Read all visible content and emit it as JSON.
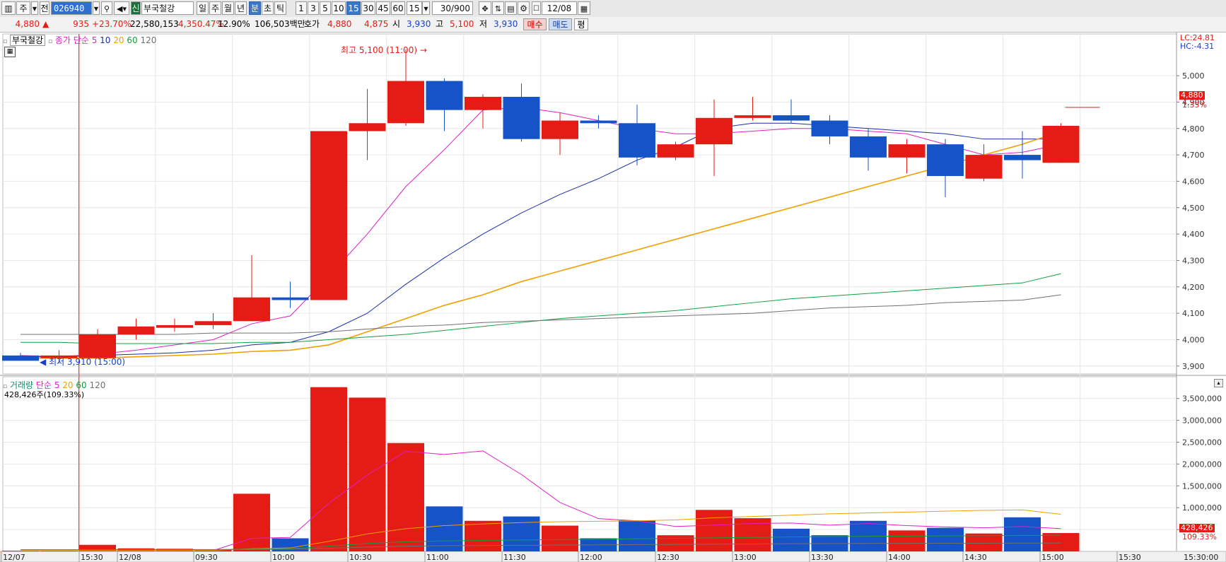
{
  "toolbar": {
    "type_selector": "주",
    "prev_label": "전",
    "stock_code": "026940",
    "sound_icon": "speaker-icon",
    "new_badge": "신",
    "stock_name": "부국철강",
    "period_day": "일",
    "period_week": "주",
    "period_month": "월",
    "period_year": "년",
    "period_minute": "분",
    "period_second": "초",
    "period_tick": "틱",
    "intervals": [
      "1",
      "3",
      "5",
      "10",
      "15",
      "30",
      "45",
      "60"
    ],
    "selected_interval": "15",
    "interval_select_value": "15",
    "count_value": "30/900",
    "date_value": "12/08"
  },
  "quote": {
    "price": "4,880",
    "change_sign": "▲",
    "change": "935",
    "change_pct": "+23.70%",
    "volume": "22,580,153",
    "volume_pct": "4,350.47%",
    "turnover": "12.90%",
    "amount": "106,503백만",
    "hoga_label": "호가",
    "ask": "4,880",
    "bid": "4,875",
    "open_label": "시",
    "open": "3,930",
    "high_label": "고",
    "high": "5,100",
    "low_label": "저",
    "low": "3,930",
    "buy_button": "매수",
    "sell_button": "매도",
    "eval_button": "평"
  },
  "price_panel": {
    "stock_label": "부국철강",
    "ma_prefix": "종가 단순",
    "ma_periods": [
      "5",
      "10",
      "20",
      "60",
      "120"
    ],
    "ma_colors": [
      "#e020c8",
      "#1a2ea8",
      "#f0a000",
      "#10a040",
      "#707070"
    ],
    "lc_label": "LC:24.81",
    "hc_label": "HC:-4.31",
    "high_annotation": "최고 5,100 (11:00)",
    "low_annotation": "최저 3,910 (15:00)",
    "current_price": "4,880",
    "current_pct": "1.35%",
    "y_ticks": [
      "5,000",
      "4,900",
      "4,800",
      "4,700",
      "4,600",
      "4,500",
      "4,400",
      "4,300",
      "4,200",
      "4,100",
      "4,000",
      "3,900"
    ]
  },
  "volume_panel": {
    "label": "거래량",
    "ma_prefix": "단순",
    "ma_periods": [
      "5",
      "20",
      "60",
      "120"
    ],
    "ma_colors": [
      "#e020c8",
      "#f0a000",
      "#10a040",
      "#707070"
    ],
    "volume_readout": "428,426주(109.33%)",
    "current_volume": "428,426",
    "current_pct": "109.33%",
    "y_ticks": [
      "3,500,000",
      "3,000,000",
      "2,500,000",
      "2,000,000",
      "1,500,000",
      "1,000,000",
      "500,000"
    ]
  },
  "x_axis": {
    "labels": [
      "12/07",
      "15:30",
      "12/08",
      "09:30",
      "10:00",
      "10:30",
      "11:00",
      "11:30",
      "12:00",
      "12:30",
      "13:00",
      "13:30",
      "14:00",
      "14:30",
      "15:00",
      "15:30",
      "15:30:00"
    ]
  },
  "colors": {
    "up": "#e51b16",
    "down": "#1652c8",
    "grid": "#e6e6e6",
    "session_line": "#e51b16"
  },
  "chart_data": {
    "type": "candlestick",
    "price_range": [
      3870,
      5110
    ],
    "volume_range": [
      0,
      3900000
    ],
    "candles": [
      {
        "t": "12/07 15:15",
        "o": 3940,
        "h": 3950,
        "l": 3920,
        "c": 3920
      },
      {
        "t": "12/07 15:30",
        "o": 3930,
        "h": 3960,
        "l": 3910,
        "c": 3940
      },
      {
        "t": "12/08 09:15",
        "o": 3930,
        "h": 4040,
        "l": 3930,
        "c": 4020
      },
      {
        "t": "12/08 09:30",
        "o": 4020,
        "h": 4080,
        "l": 4000,
        "c": 4050
      },
      {
        "t": "12/08 09:45",
        "o": 4045,
        "h": 4080,
        "l": 4030,
        "c": 4055
      },
      {
        "t": "12/08 10:00",
        "o": 4055,
        "h": 4100,
        "l": 4040,
        "c": 4070
      },
      {
        "t": "12/08 10:15",
        "o": 4070,
        "h": 4320,
        "l": 4070,
        "c": 4160
      },
      {
        "t": "12/08 10:30",
        "o": 4160,
        "h": 4220,
        "l": 4120,
        "c": 4150
      },
      {
        "t": "12/08 10:45",
        "o": 4150,
        "h": 4790,
        "l": 4150,
        "c": 4790
      },
      {
        "t": "12/08 11:00",
        "o": 4790,
        "h": 4950,
        "l": 4680,
        "c": 4820
      },
      {
        "t": "12/08 11:15",
        "o": 4820,
        "h": 5100,
        "l": 4810,
        "c": 4980
      },
      {
        "t": "12/08 11:30",
        "o": 4980,
        "h": 4990,
        "l": 4790,
        "c": 4870
      },
      {
        "t": "12/08 11:45",
        "o": 4870,
        "h": 4930,
        "l": 4800,
        "c": 4920
      },
      {
        "t": "12/08 12:00",
        "o": 4920,
        "h": 4970,
        "l": 4750,
        "c": 4760
      },
      {
        "t": "12/08 12:15",
        "o": 4760,
        "h": 4860,
        "l": 4700,
        "c": 4830
      },
      {
        "t": "12/08 12:30",
        "o": 4830,
        "h": 4850,
        "l": 4800,
        "c": 4820
      },
      {
        "t": "12/08 12:45",
        "o": 4820,
        "h": 4890,
        "l": 4660,
        "c": 4690
      },
      {
        "t": "12/08 13:00",
        "o": 4690,
        "h": 4750,
        "l": 4680,
        "c": 4740
      },
      {
        "t": "12/08 13:15",
        "o": 4740,
        "h": 4910,
        "l": 4620,
        "c": 4840
      },
      {
        "t": "12/08 13:30",
        "o": 4840,
        "h": 4920,
        "l": 4830,
        "c": 4850
      },
      {
        "t": "12/08 13:45",
        "o": 4850,
        "h": 4910,
        "l": 4820,
        "c": 4830
      },
      {
        "t": "12/08 14:00",
        "o": 4830,
        "h": 4850,
        "l": 4740,
        "c": 4770
      },
      {
        "t": "12/08 14:15",
        "o": 4770,
        "h": 4800,
        "l": 4640,
        "c": 4690
      },
      {
        "t": "12/08 14:30",
        "o": 4690,
        "h": 4760,
        "l": 4630,
        "c": 4740
      },
      {
        "t": "12/08 14:45",
        "o": 4740,
        "h": 4760,
        "l": 4540,
        "c": 4620
      },
      {
        "t": "12/08 15:00",
        "o": 4610,
        "h": 4740,
        "l": 4600,
        "c": 4700
      },
      {
        "t": "12/08 15:15",
        "o": 4700,
        "h": 4790,
        "l": 4610,
        "c": 4680
      },
      {
        "t": "12/08 15:30",
        "o": 4670,
        "h": 4820,
        "l": 4670,
        "c": 4810
      }
    ],
    "volumes": [
      15000,
      16000,
      150000,
      70000,
      60000,
      50000,
      1320000,
      300000,
      3760000,
      3520000,
      2480000,
      1030000,
      700000,
      800000,
      590000,
      300000,
      710000,
      370000,
      950000,
      760000,
      520000,
      370000,
      700000,
      480000,
      540000,
      410000,
      780000,
      420000
    ],
    "ma": {
      "5": [
        3940,
        3935,
        3945,
        3960,
        3980,
        4000,
        4060,
        4090,
        4240,
        4400,
        4580,
        4720,
        4870,
        4880,
        4860,
        4830,
        4800,
        4780,
        4780,
        4790,
        4800,
        4800,
        4790,
        4780,
        4740,
        4700,
        4710,
        4740
      ],
      "10": [
        3935,
        3935,
        3940,
        3945,
        3950,
        3960,
        3980,
        3990,
        4030,
        4100,
        4210,
        4310,
        4400,
        4480,
        4550,
        4610,
        4680,
        4730,
        4800,
        4820,
        4820,
        4810,
        4800,
        4790,
        4780,
        4760,
        4760,
        4760
      ],
      "20": [
        3930,
        3930,
        3930,
        3935,
        3940,
        3945,
        3955,
        3960,
        3980,
        4030,
        4080,
        4130,
        4170,
        4220,
        4260,
        4300,
        4340,
        4380,
        4420,
        4460,
        4500,
        4540,
        4580,
        4620,
        4660,
        4700,
        4740,
        4790
      ],
      "60": [
        3990,
        3990,
        3985,
        3985,
        3985,
        3985,
        3990,
        3990,
        4000,
        4010,
        4020,
        4035,
        4050,
        4065,
        4080,
        4090,
        4100,
        4110,
        4125,
        4140,
        4155,
        4165,
        4175,
        4185,
        4195,
        4205,
        4215,
        4250
      ],
      "120": [
        4020,
        4020,
        4020,
        4020,
        4020,
        4025,
        4025,
        4025,
        4030,
        4040,
        4050,
        4055,
        4065,
        4070,
        4075,
        4080,
        4085,
        4090,
        4095,
        4100,
        4110,
        4120,
        4125,
        4130,
        4140,
        4145,
        4150,
        4170
      ]
    },
    "vol_ma": {
      "5": [
        15000,
        15000,
        15000,
        15000,
        15000,
        20000,
        300000,
        320000,
        1100000,
        1750000,
        2290000,
        2220000,
        2300000,
        1760000,
        1120000,
        750000,
        700000,
        570000,
        600000,
        640000,
        650000,
        600000,
        640000,
        590000,
        560000,
        540000,
        570000,
        520000
      ],
      "20": [
        20000,
        20000,
        20000,
        20000,
        20000,
        25000,
        60000,
        80000,
        230000,
        400000,
        520000,
        590000,
        630000,
        660000,
        680000,
        690000,
        700000,
        720000,
        770000,
        800000,
        830000,
        860000,
        880000,
        900000,
        920000,
        940000,
        950000,
        850000
      ],
      "60": [
        40000,
        40000,
        40000,
        40000,
        40000,
        40000,
        50000,
        60000,
        120000,
        180000,
        220000,
        240000,
        250000,
        260000,
        270000,
        280000,
        290000,
        300000,
        310000,
        320000,
        330000,
        340000,
        345000,
        350000,
        355000,
        360000,
        365000,
        370000
      ],
      "120": [
        40000,
        40000,
        40000,
        40000,
        40000,
        40000,
        45000,
        50000,
        70000,
        100000,
        120000,
        130000,
        135000,
        140000,
        145000,
        150000,
        155000,
        160000,
        165000,
        170000,
        175000,
        180000,
        182000,
        184000,
        186000,
        188000,
        190000,
        192000
      ]
    }
  }
}
